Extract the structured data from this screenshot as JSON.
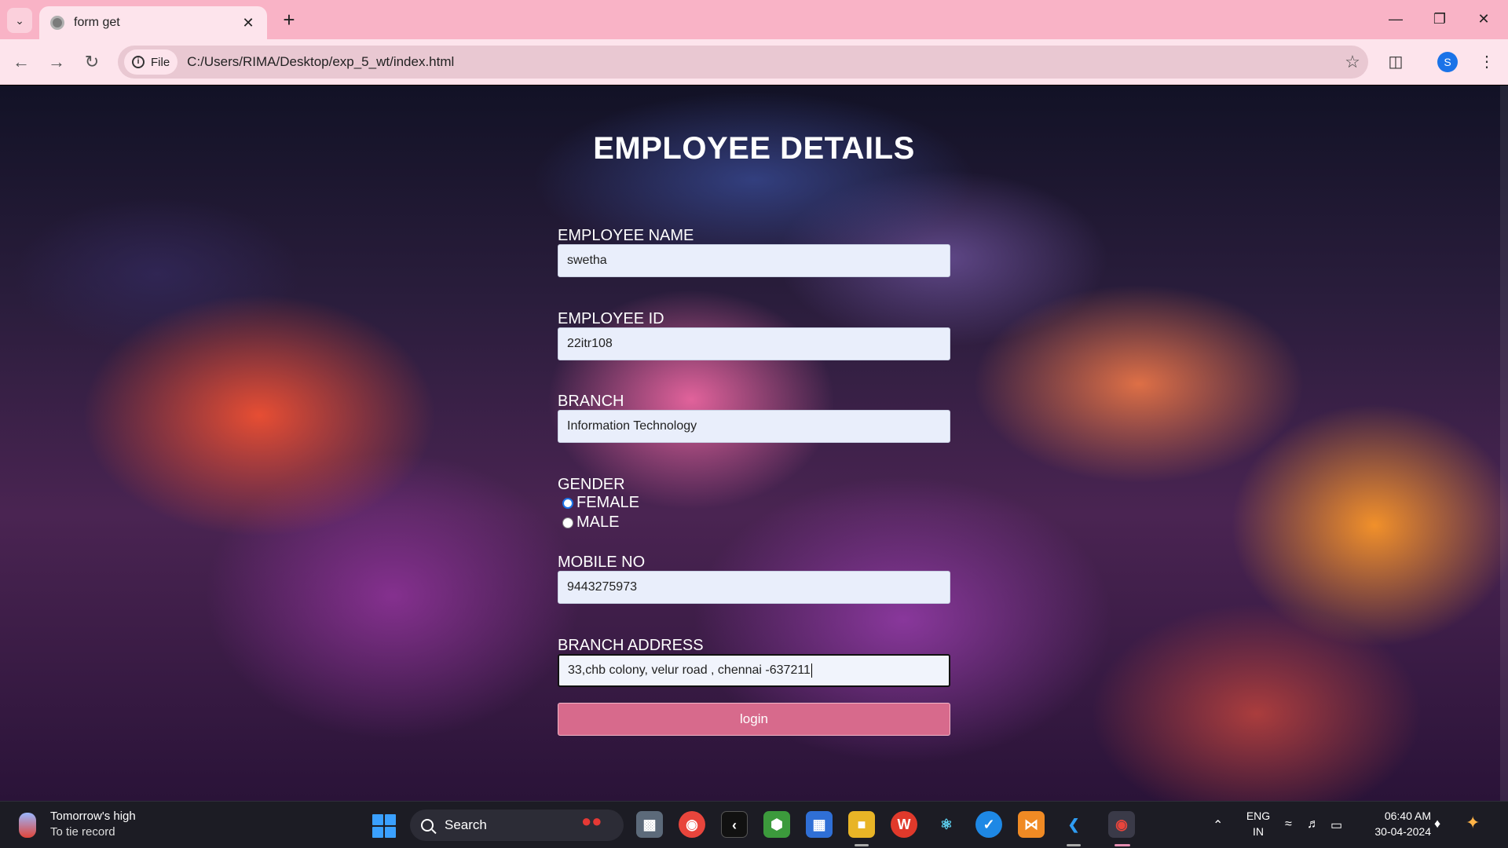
{
  "browser": {
    "tab_title": "form get",
    "site_chip": "File",
    "url": "C:/Users/RIMA/Desktop/exp_5_wt/index.html",
    "profile_initial": "S"
  },
  "page": {
    "heading": "EMPLOYEE DETAILS",
    "fields": {
      "name_label": "EMPLOYEE NAME",
      "name_value": "swetha",
      "id_label": "EMPLOYEE ID",
      "id_value": "22itr108",
      "branch_label": "BRANCH",
      "branch_value": "Information Technology",
      "gender_label": "GENDER",
      "gender_female": "FEMALE",
      "gender_male": "MALE",
      "gender_selected": "FEMALE",
      "mobile_label": "MOBILE NO",
      "mobile_value": "9443275973",
      "address_label": "BRANCH ADDRESS",
      "address_value": "33,chb colony, velur road , chennai -637211"
    },
    "submit_label": "login"
  },
  "taskbar": {
    "weather_title": "Tomorrow's high",
    "weather_sub": "To tie record",
    "search_placeholder": "Search",
    "lang_top": "ENG",
    "lang_bottom": "IN",
    "time": "06:40 AM",
    "date": "30-04-2024"
  },
  "colors": {
    "tabbar": "#f9b3c6",
    "button": "#d76a8c",
    "taskbar": "#1c1c24"
  }
}
